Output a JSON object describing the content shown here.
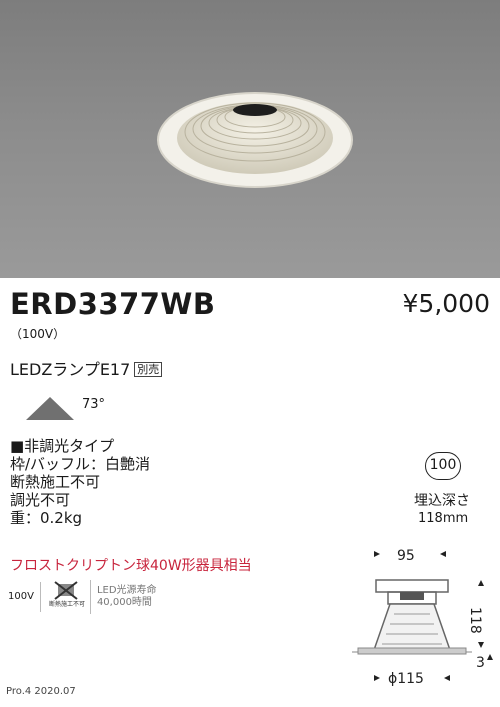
{
  "product": {
    "model": "ERD3377WB",
    "price": "¥5,000",
    "voltage_note": "（100V）",
    "lamp": "LEDZランプE17",
    "lamp_badge": "別売",
    "beam_angle": "73°",
    "specs": [
      "■非調光タイプ",
      "枠/バッフル：白艶消",
      "断熱施工不可",
      "調光不可",
      "重：0.2kg"
    ],
    "equivalent": "フロストクリプトン球40W形器具相当"
  },
  "icons": {
    "voltage": "100V",
    "heat_caption": "断熱施工不可",
    "led_life_title": "LED光源寿命",
    "led_life_value": "40,000時間"
  },
  "install": {
    "depth_badge": "100",
    "depth_label": "埋込深さ",
    "depth_value": "118mm"
  },
  "dimensions": {
    "width": "95",
    "height": "118",
    "offset": "3",
    "cutout": "ϕ115"
  },
  "footer": {
    "version": "Pro.4 2020.07"
  }
}
